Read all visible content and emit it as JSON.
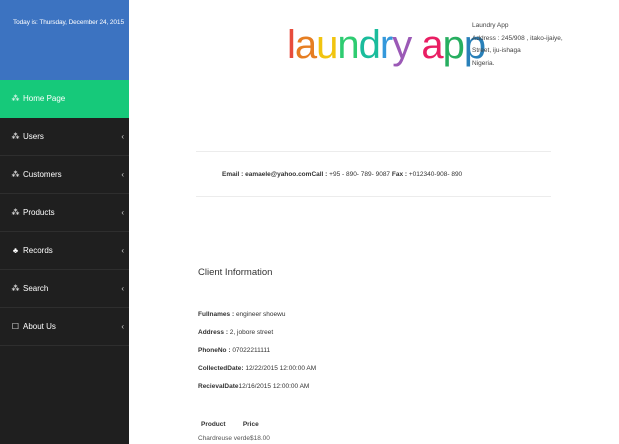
{
  "sidebar": {
    "date_text": "Today is: Thursday, December 24, 2015",
    "items": [
      {
        "label": "Home Page",
        "icon": "puzzle-icon",
        "glyph": "⁂",
        "chevron": ""
      },
      {
        "label": "Users",
        "icon": "puzzle-icon",
        "glyph": "⁂",
        "chevron": "‹"
      },
      {
        "label": "Customers",
        "icon": "puzzle-icon",
        "glyph": "⁂",
        "chevron": "‹"
      },
      {
        "label": "Products",
        "icon": "puzzle-icon",
        "glyph": "⁂",
        "chevron": "‹"
      },
      {
        "label": "Records",
        "icon": "sitemap-icon",
        "glyph": "♣",
        "chevron": "‹"
      },
      {
        "label": "Search",
        "icon": "puzzle-icon",
        "glyph": "⁂",
        "chevron": "‹"
      },
      {
        "label": "About Us",
        "icon": "square-icon",
        "glyph": "☐",
        "chevron": "‹"
      }
    ]
  },
  "header": {
    "logo_text": "laundry app",
    "logo_colors": [
      "#e74c3c",
      "#e67e22",
      "#f1c40f",
      "#2ecc71",
      "#1abc9c",
      "#3498db",
      "#9b59b6",
      "#e91e63",
      "#27ae60",
      "#2980b9",
      "#8e44ad"
    ],
    "company": {
      "name": "Laundry App",
      "address_line1": "Address : 245/908 , itako-ijaiye,",
      "address_line2": "Street, iju-ishaga",
      "address_line3": "Nigeria."
    }
  },
  "contact": {
    "email_label": "Email :",
    "email_value": "eamaele@yahoo.com",
    "call_label": "Call :",
    "call_value": "+95 - 890- 789- 9087",
    "fax_label": "Fax :",
    "fax_value": "+012340-908- 890"
  },
  "client": {
    "section_title": "Client Information",
    "fullnames_label": "Fullnames :",
    "fullnames_value": "engineer shoewu",
    "address_label": "Address :",
    "address_value": "2, jobore street",
    "phone_label": "PhoneNo :",
    "phone_value": "07022211111",
    "collected_label": "CollectedDate:",
    "collected_value": "12/22/2015 12:00:00 AM",
    "recieval_label": "RecievalDate",
    "recieval_value": "12/16/2015 12:00:00 AM"
  },
  "products": {
    "headers": [
      "Product",
      "Price"
    ],
    "rows": [
      {
        "product": "Chardreuse verde",
        "price": "$18.00"
      }
    ]
  }
}
